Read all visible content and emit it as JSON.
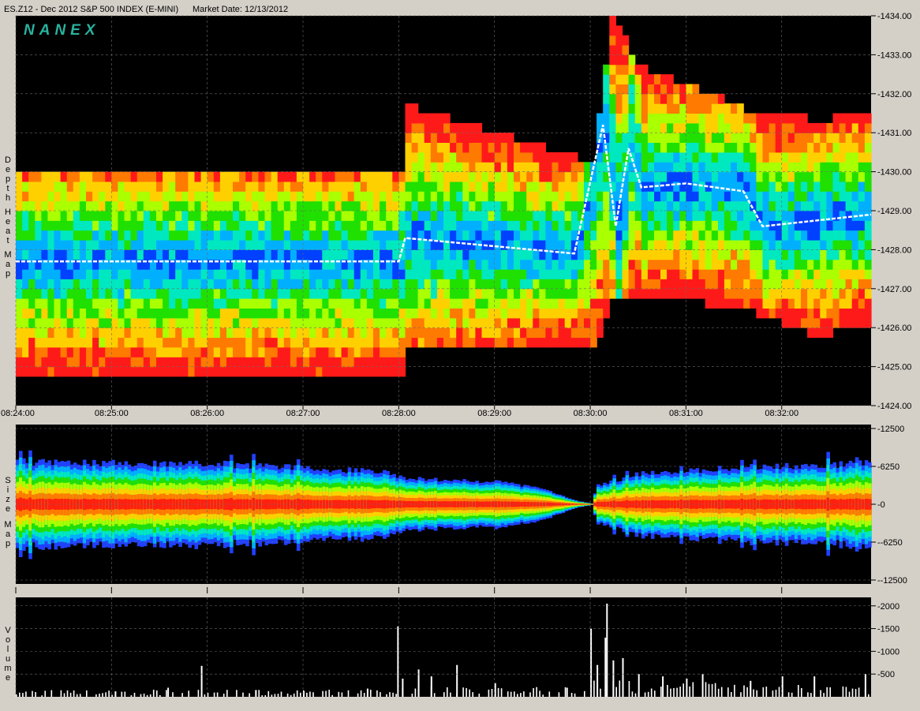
{
  "header": {
    "title": "ES.Z12 - Dec 2012 S&P 500 INDEX (E-MINI)",
    "market_date": "Market Date: 12/13/2012"
  },
  "brand": {
    "logo_text": "NANEX",
    "color": "#29b3a0"
  },
  "chart_data": [
    {
      "type": "heatmap",
      "panel_label": "Depth Heat Map",
      "x_ticks": [
        "08:24:00",
        "08:25:00",
        "08:26:00",
        "08:27:00",
        "08:28:00",
        "08:29:00",
        "08:30:00",
        "08:31:00",
        "08:32:00"
      ],
      "xlim": [
        "08:24:00",
        "08:32:56"
      ],
      "y_ticks": [
        "1424.00",
        "1425.00",
        "1426.00",
        "1427.00",
        "1428.00",
        "1429.00",
        "1430.00",
        "1431.00",
        "1432.00",
        "1433.00",
        "1434.00"
      ],
      "ylim": [
        1424,
        1434
      ],
      "grid": true,
      "colorscale": [
        "#ff1a1a",
        "#ff7a00",
        "#ffd000",
        "#aaff00",
        "#20e000",
        "#00e8c0",
        "#00b0ff",
        "#0040ff"
      ],
      "best_bid_ask_trace": [
        {
          "t": "08:24:00",
          "price": 1427.7
        },
        {
          "t": "08:28:00",
          "price": 1427.7
        },
        {
          "t": "08:28:04",
          "price": 1428.3
        },
        {
          "t": "08:29:50",
          "price": 1427.9
        },
        {
          "t": "08:30:08",
          "price": 1431.2
        },
        {
          "t": "08:30:16",
          "price": 1428.6
        },
        {
          "t": "08:30:24",
          "price": 1430.6
        },
        {
          "t": "08:30:32",
          "price": 1429.6
        },
        {
          "t": "08:31:00",
          "price": 1429.7
        },
        {
          "t": "08:31:36",
          "price": 1429.5
        },
        {
          "t": "08:31:48",
          "price": 1428.6
        },
        {
          "t": "08:32:56",
          "price": 1428.9
        }
      ],
      "depth_envelope": [
        {
          "t": "08:24:00",
          "low": 1424.8,
          "high": 1429.9
        },
        {
          "t": "08:28:00",
          "low": 1424.9,
          "high": 1429.9
        },
        {
          "t": "08:28:04",
          "low": 1425.7,
          "high": 1431.6
        },
        {
          "t": "08:30:00",
          "low": 1425.5,
          "high": 1430.1
        },
        {
          "t": "08:30:06",
          "low": 1426.2,
          "high": 1432.0
        },
        {
          "t": "08:30:12",
          "low": 1426.8,
          "high": 1433.8
        },
        {
          "t": "08:30:30",
          "low": 1427.0,
          "high": 1432.6
        },
        {
          "t": "08:31:36",
          "low": 1426.6,
          "high": 1431.5
        },
        {
          "t": "08:32:20",
          "low": 1425.9,
          "high": 1431.2
        },
        {
          "t": "08:32:56",
          "low": 1426.2,
          "high": 1431.4
        }
      ]
    },
    {
      "type": "area",
      "panel_label": "Size Map",
      "y_ticks": [
        "12500",
        "6250",
        "0",
        "-6250",
        "-12500"
      ],
      "ylim": [
        -12500,
        12500
      ],
      "grid": true,
      "colorscale": [
        "#ff2010",
        "#ff7a00",
        "#ffd000",
        "#aaff00",
        "#20e000",
        "#00e8c0",
        "#00b0ff",
        "#2040ff"
      ],
      "size_envelope": [
        {
          "t": "08:24:00",
          "value": 7000
        },
        {
          "t": "08:25:00",
          "value": 6800
        },
        {
          "t": "08:26:00",
          "value": 6700
        },
        {
          "t": "08:27:00",
          "value": 6000
        },
        {
          "t": "08:27:55",
          "value": 5200
        },
        {
          "t": "08:28:00",
          "value": 4500
        },
        {
          "t": "08:28:30",
          "value": 3900
        },
        {
          "t": "08:29:00",
          "value": 3700
        },
        {
          "t": "08:29:30",
          "value": 2500
        },
        {
          "t": "08:29:50",
          "value": 600
        },
        {
          "t": "08:30:00",
          "value": 150
        },
        {
          "t": "08:30:04",
          "value": 3200
        },
        {
          "t": "08:30:30",
          "value": 5000
        },
        {
          "t": "08:31:00",
          "value": 5500
        },
        {
          "t": "08:31:30",
          "value": 6000
        },
        {
          "t": "08:32:00",
          "value": 6300
        },
        {
          "t": "08:32:56",
          "value": 6700
        }
      ]
    },
    {
      "type": "bar",
      "panel_label": "Volume",
      "y_ticks": [
        "2000",
        "1500",
        "1000",
        "500"
      ],
      "ylim": [
        0,
        2100
      ],
      "grid": true,
      "spikes": [
        {
          "t": "08:25:02",
          "value": 120
        },
        {
          "t": "08:25:35",
          "value": 200
        },
        {
          "t": "08:25:56",
          "value": 680
        },
        {
          "t": "08:26:30",
          "value": 150
        },
        {
          "t": "08:27:00",
          "value": 120
        },
        {
          "t": "08:27:40",
          "value": 180
        },
        {
          "t": "08:27:59",
          "value": 1550
        },
        {
          "t": "08:28:02",
          "value": 400
        },
        {
          "t": "08:28:12",
          "value": 600
        },
        {
          "t": "08:28:20",
          "value": 450
        },
        {
          "t": "08:28:36",
          "value": 700
        },
        {
          "t": "08:29:00",
          "value": 300
        },
        {
          "t": "08:29:45",
          "value": 200
        },
        {
          "t": "08:30:00",
          "value": 1500
        },
        {
          "t": "08:30:04",
          "value": 700
        },
        {
          "t": "08:30:09",
          "value": 1300
        },
        {
          "t": "08:30:10",
          "value": 2050
        },
        {
          "t": "08:30:14",
          "value": 800
        },
        {
          "t": "08:30:20",
          "value": 850
        },
        {
          "t": "08:30:30",
          "value": 500
        },
        {
          "t": "08:30:45",
          "value": 450
        },
        {
          "t": "08:31:00",
          "value": 400
        },
        {
          "t": "08:31:10",
          "value": 500
        },
        {
          "t": "08:31:40",
          "value": 350
        },
        {
          "t": "08:32:00",
          "value": 450
        },
        {
          "t": "08:32:20",
          "value": 450
        },
        {
          "t": "08:32:52",
          "value": 500
        }
      ],
      "baseline_by_minute": [
        {
          "t": "08:24:00",
          "value": 160
        },
        {
          "t": "08:27:59",
          "value": 160
        },
        {
          "t": "08:28:00",
          "value": 260
        },
        {
          "t": "08:29:59",
          "value": 220
        },
        {
          "t": "08:30:00",
          "value": 380
        },
        {
          "t": "08:32:56",
          "value": 260
        }
      ]
    }
  ]
}
